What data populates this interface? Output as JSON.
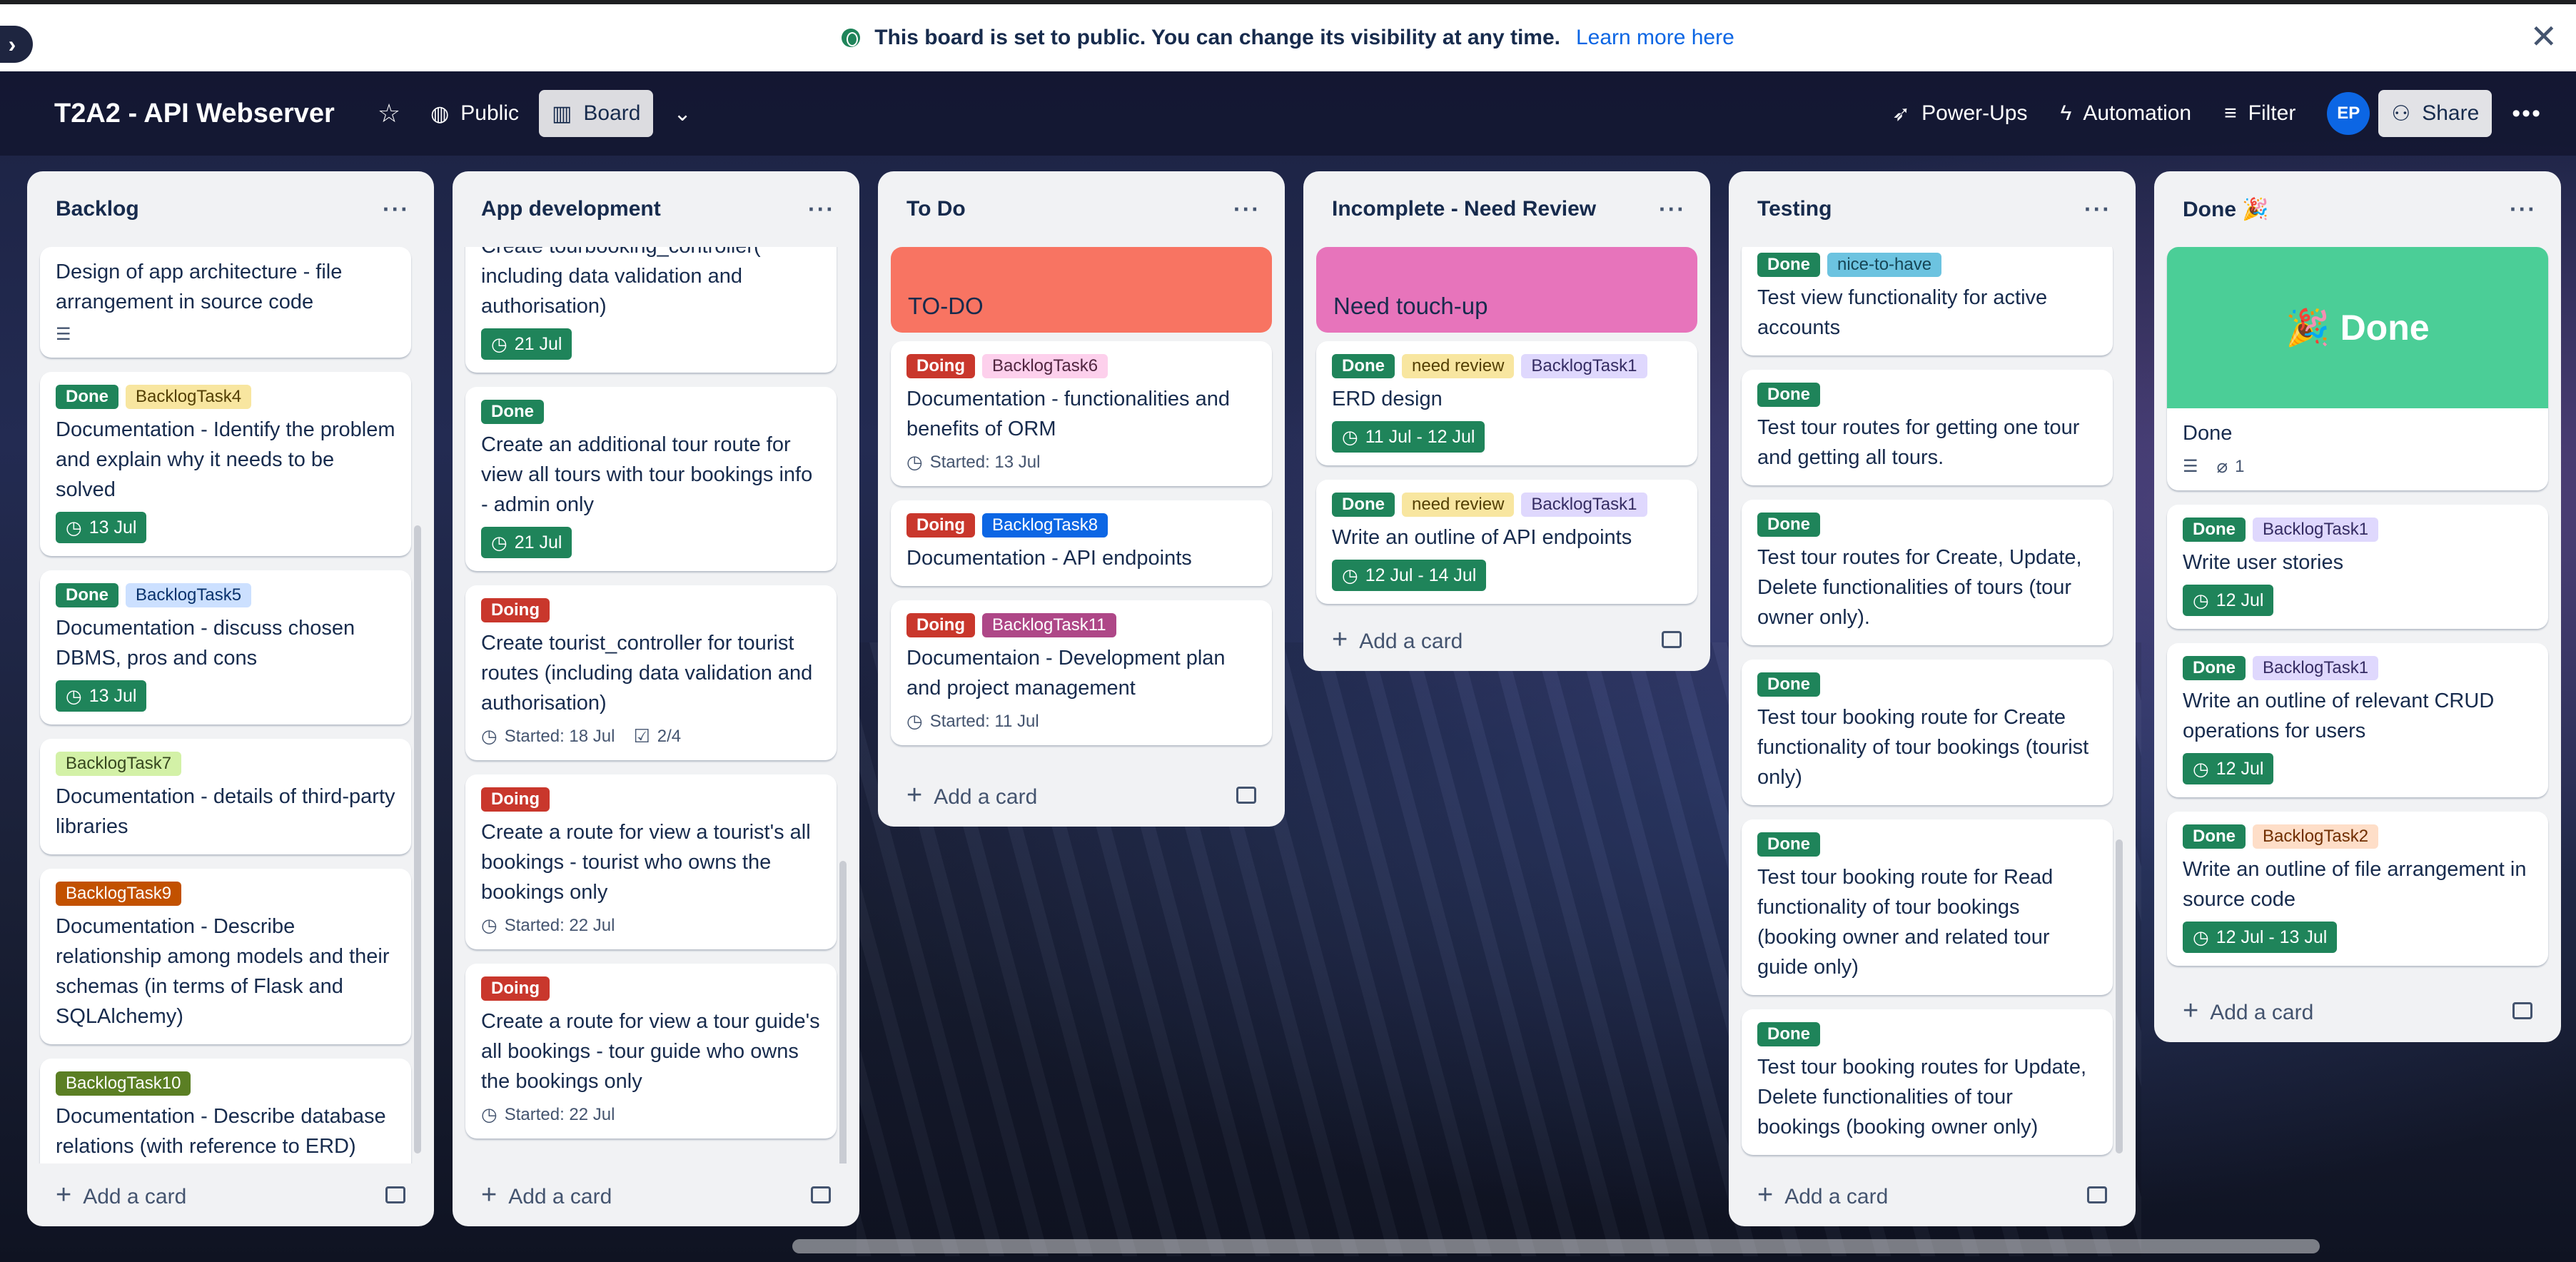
{
  "banner": {
    "message": "This board is set to public. You can change its visibility at any time.",
    "link": "Learn more here"
  },
  "header": {
    "board_title": "T2A2 - API Webserver",
    "visibility": "Public",
    "view": "Board",
    "powerups": "Power-Ups",
    "automation": "Automation",
    "filter": "Filter",
    "avatar_initials": "EP",
    "share": "Share"
  },
  "add_card_label": "Add a card",
  "lists": {
    "backlog": {
      "title": "Backlog",
      "cards": [
        {
          "text": "Design of app architecture - file arrangement in source code"
        },
        {
          "labels": [
            "Done",
            "BacklogTask4"
          ],
          "text": "Documentation - Identify the problem and explain why it needs to be solved",
          "date": "13 Jul"
        },
        {
          "labels": [
            "Done",
            "BacklogTask5"
          ],
          "text": "Documentation - discuss chosen DBMS, pros and cons",
          "date": "13 Jul"
        },
        {
          "labels": [
            "BacklogTask7"
          ],
          "text": "Documentation - details of third-party libraries"
        },
        {
          "labels": [
            "BacklogTask9"
          ],
          "text": "Documentation - Describe relationship among models and their schemas (in terms of Flask and SQLAlchemy)"
        },
        {
          "labels": [
            "BacklogTask10"
          ],
          "text": "Documentation - Describe database relations (with reference to ERD)"
        }
      ]
    },
    "appdev": {
      "title": "App development",
      "cards": [
        {
          "text": "Create tourbooking_controller( including data validation and authorisation)",
          "date": "21 Jul"
        },
        {
          "labels": [
            "Done"
          ],
          "text": "Create an additional tour route for view all tours with tour bookings info - admin only",
          "date": "21 Jul"
        },
        {
          "labels": [
            "Doing"
          ],
          "text": "Create tourist_controller for tourist routes (including data validation and authorisation)",
          "started": "Started: 18 Jul",
          "checklist": "2/4"
        },
        {
          "labels": [
            "Doing"
          ],
          "text": "Create a route for view a tourist's all bookings - tourist who owns the bookings only",
          "started": "Started: 22 Jul"
        },
        {
          "labels": [
            "Doing"
          ],
          "text": "Create a route for view a tour guide's all bookings - tour guide who owns the bookings only",
          "started": "Started: 22 Jul"
        }
      ]
    },
    "todo": {
      "title": "To Do",
      "cover_text": "TO-DO",
      "cards": [
        {
          "labels": [
            "Doing",
            "BacklogTask6"
          ],
          "text": "Documentation - functionalities and benefits of ORM",
          "started": "Started: 13 Jul"
        },
        {
          "labels": [
            "Doing",
            "BacklogTask8"
          ],
          "text": "Documentation - API endpoints"
        },
        {
          "labels": [
            "Doing",
            "BacklogTask11"
          ],
          "text": "Documentaion - Development plan and project management",
          "started": "Started: 11 Jul"
        }
      ]
    },
    "review": {
      "title": "Incomplete - Need Review",
      "cover_text": "Need touch-up",
      "cards": [
        {
          "labels": [
            "Done",
            "need review",
            "BacklogTask1"
          ],
          "text": "ERD design",
          "date": "11 Jul - 12 Jul"
        },
        {
          "labels": [
            "Done",
            "need review",
            "BacklogTask1"
          ],
          "text": "Write an outline of API endpoints",
          "date": "12 Jul - 14 Jul"
        }
      ]
    },
    "testing": {
      "title": "Testing",
      "cards": [
        {
          "labels": [
            "Done",
            "nice-to-have"
          ],
          "text": "Test view functionality for active accounts"
        },
        {
          "labels": [
            "Done"
          ],
          "text": "Test tour routes for getting one tour and getting all tours."
        },
        {
          "labels": [
            "Done"
          ],
          "text": "Test tour routes for Create, Update, Delete functionalities of tours (tour owner only)."
        },
        {
          "labels": [
            "Done"
          ],
          "text": "Test tour booking route for Create functionality of tour bookings (tourist only)"
        },
        {
          "labels": [
            "Done"
          ],
          "text": "Test tour booking route for Read functionality of tour bookings (booking owner and related tour guide only)"
        },
        {
          "labels": [
            "Done"
          ],
          "text": "Test tour booking routes for Update, Delete functionalities of tour bookings (booking owner only)"
        }
      ]
    },
    "done": {
      "title": "Done 🎉",
      "cover_text": "🎉 Done",
      "cover_card_text": "Done",
      "cover_card_attachments": "1",
      "cards": [
        {
          "labels": [
            "Done",
            "BacklogTask1"
          ],
          "text": "Write user stories",
          "date": "12 Jul"
        },
        {
          "labels": [
            "Done",
            "BacklogTask1"
          ],
          "text": "Write an outline of relevant CRUD operations for users",
          "date": "12 Jul"
        },
        {
          "labels": [
            "Done",
            "BacklogTask2"
          ],
          "text": "Write an outline of file arrangement in source code",
          "date": "12 Jul - 13 Jul"
        }
      ]
    }
  },
  "colors": {
    "done_label": "#1f845a",
    "doing_label": "#c9372c",
    "todo_cover": "#f87462",
    "review_cover": "#e774bb",
    "done_cover": "#4bce97"
  }
}
